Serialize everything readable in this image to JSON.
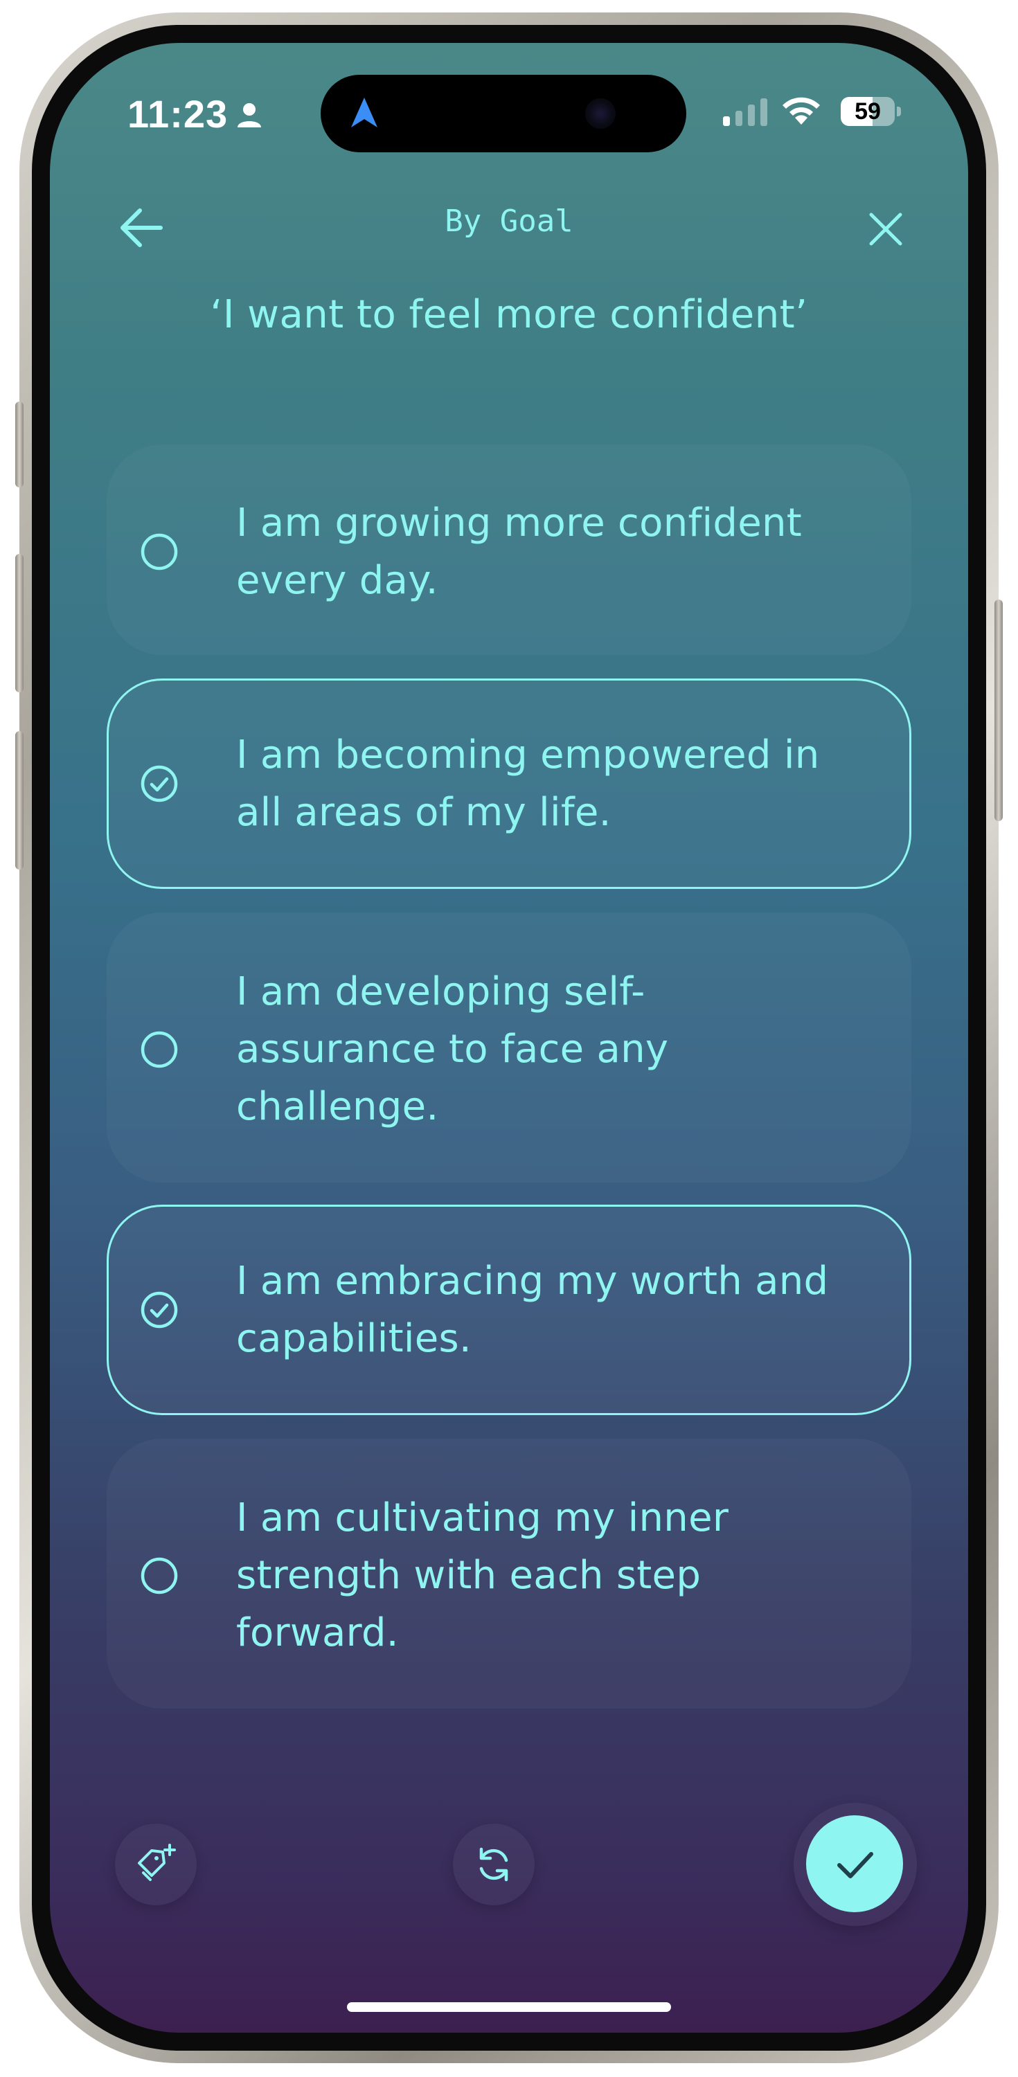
{
  "status_bar": {
    "time": "11:23",
    "battery_level": "59",
    "battery_fraction": 0.59
  },
  "nav": {
    "title": "By Goal",
    "back_icon": "arrow-left-icon",
    "close_icon": "close-icon"
  },
  "goal": {
    "heading": "‘I want to feel more confident’"
  },
  "affirmations": [
    {
      "lines": [
        "I am growing more confident",
        "every day."
      ],
      "selected": false
    },
    {
      "lines": [
        "I am becoming empowered in",
        "all areas of my life."
      ],
      "selected": true
    },
    {
      "lines": [
        "I am developing self-",
        "assurance to face any",
        "challenge."
      ],
      "selected": false
    },
    {
      "lines": [
        "I am embracing my worth and",
        "capabilities."
      ],
      "selected": true
    },
    {
      "lines": [
        "I am cultivating my inner",
        "strength with each step",
        "forward."
      ],
      "selected": false
    }
  ],
  "toolbar": {
    "tag_icon": "tag-add-icon",
    "refresh_icon": "refresh-icon",
    "confirm_icon": "check-icon"
  },
  "colors": {
    "accent": "#8ff5f0",
    "bg_top": "#4a8888",
    "bg_bottom": "#3c2050"
  }
}
